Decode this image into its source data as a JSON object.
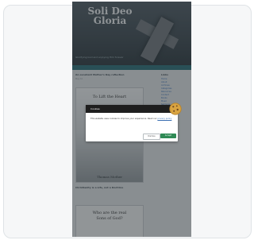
{
  "blog": {
    "title_line1": "Soli Deo",
    "title_line2": "Gloria",
    "tagline": "Glorifying God and enjoying Him forever",
    "posts": [
      {
        "title": "An excellent Mother's Day reflection",
        "meta": "May 10",
        "thumb_text": "To Lift the Heart",
        "thumb_footer": "Thomas Mother"
      },
      {
        "title": "Christianity is a Life, not a Doctrine",
        "thumb_text_line1": "Who are the real",
        "thumb_text_line2": "Sons of God?"
      }
    ],
    "sidebar": {
      "heading": "Links",
      "items": [
        "Home",
        "About",
        "Archives",
        "Categories",
        "Resources",
        "Contact",
        "Books",
        "Music",
        "Sermons",
        "Devotions",
        "Prayer",
        "Missions",
        "Family",
        "Church",
        "Links"
      ]
    }
  },
  "modal": {
    "title": "Cookies",
    "body": "This website uses cookies to improve your experience. Read our",
    "link": "privacy policy",
    "btn_decline": "Dismiss",
    "btn_accept": "Accept"
  },
  "colors": {
    "accent": "#2f8a55",
    "header": "#3b464d"
  }
}
